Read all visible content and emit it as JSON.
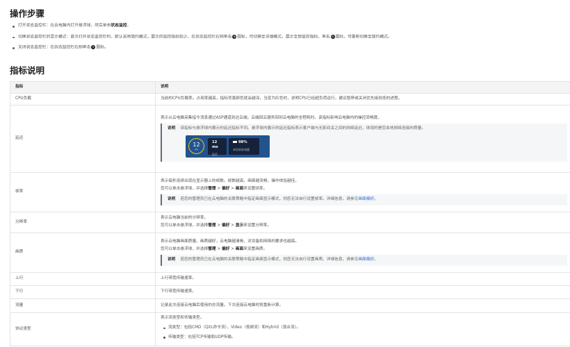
{
  "steps": {
    "title": "操作步骤",
    "items": [
      {
        "text": "打开状态监控栏：在云电脑内打开悬浮球，然后单击",
        "bold": "状态监控",
        "tail": "。"
      },
      {
        "text": "切换状态监控栏的显示模式：首次打开状态监控栏时，默认采用简约模式，展示的监控指标较少。在状态监控栏右侧单击",
        "icon1": "⊕",
        "text2": "图标，可切换至详细模式，展示全部监控指标。单击",
        "icon2": "⊖",
        "text3": "图标，可重新切换至简约模式。"
      },
      {
        "text": "关闭状态监控栏：在状态监控栏右侧单击",
        "icon": "×",
        "tail": "图标。"
      }
    ]
  },
  "indicators": {
    "title": "指标说明",
    "headers": [
      "指标",
      "说明"
    ],
    "rows": [
      {
        "name": "CPU负载",
        "desc": "当前的CPU负载率。占用率越高，指标背景颜色就会越深，当变为红色时，说明CPU已经超负荷运行，建议暂停或关闭优先级较低的进程。"
      },
      {
        "name": "延迟",
        "desc": "表示从云电脑采集指令消息通过ASP通道到达云端，云端回云服务回到云电脑的全程耗时。该指标影响云电脑内的操控流畅度。",
        "note_label": "说明",
        "note": "该指标与悬浮球内展示的延迟指标不同。悬浮球内展示的延迟指标表示客户端与无影间关之间的网络延迟，体现的是您本地网络连接的质量。",
        "panel": {
          "circle_value": "12",
          "circle_unit": "ms",
          "box1_value": "12 ms",
          "box1_label": "延迟",
          "box2_value": "98%",
          "box2_label": "本机实际电量"
        }
      },
      {
        "name": "帧率",
        "desc": "表示每秒连续出现在显示器上的帧数。帧数越高，画面越流畅，操作体验越佳。",
        "how_pre": "您可以单击悬浮球，并选择",
        "path": [
          "管理",
          "偏好",
          "画面"
        ],
        "how_post": "来设置帧率。",
        "note_label": "说明",
        "note": "若您的管理员已在云电脑的关联策略中指定画面显示模式，则您无法自行设置帧率。详细信息，请参见",
        "note_link": "画面偏好",
        "note_tail": "。"
      },
      {
        "name": "分辨率",
        "desc": "表示云电脑当前的分辨率。",
        "how_pre": "您可以单击悬浮球，并选择",
        "path": [
          "管理",
          "偏好",
          "显示"
        ],
        "how_post": "来设置分辨率。"
      },
      {
        "name": "画质",
        "desc": "表示云电脑画面质量。画质越好，云电脑越清晰，对设备和网络的要求也越高。",
        "how_pre": "您可以单击悬浮球，并选择",
        "path": [
          "管理",
          "偏好",
          "画面"
        ],
        "how_post": "来设置画质。",
        "note_label": "说明",
        "note": "若您的管理员已在云电脑的关联策略中指定画面显示模式，则您无法自行设置画质。详细信息，请参见",
        "note_link": "画面偏好",
        "note_tail": "。"
      },
      {
        "name": "上行",
        "desc": "上行带宽传输速率。"
      },
      {
        "name": "下行",
        "desc": "下行带宽传输速率。"
      },
      {
        "name": "流量",
        "desc": "记录此次连接云电脑后使用的总流量。下次连接云电脑时将重新计算。"
      },
      {
        "name": "协议类型",
        "desc": "表示流类型和传输类型。",
        "bullets": [
          "流类型：包括CMD（QXL命令流）、Video（视频流）和Hybrid（混合流）。",
          "传输类型：包括TCP传输和UDP传输。"
        ]
      }
    ]
  },
  "colors": {
    "accent_link": "#2a6fd6",
    "panel_bg": "#21548f",
    "circle_ring": "#f1c41a",
    "note_bar": "#5f6b7a"
  }
}
